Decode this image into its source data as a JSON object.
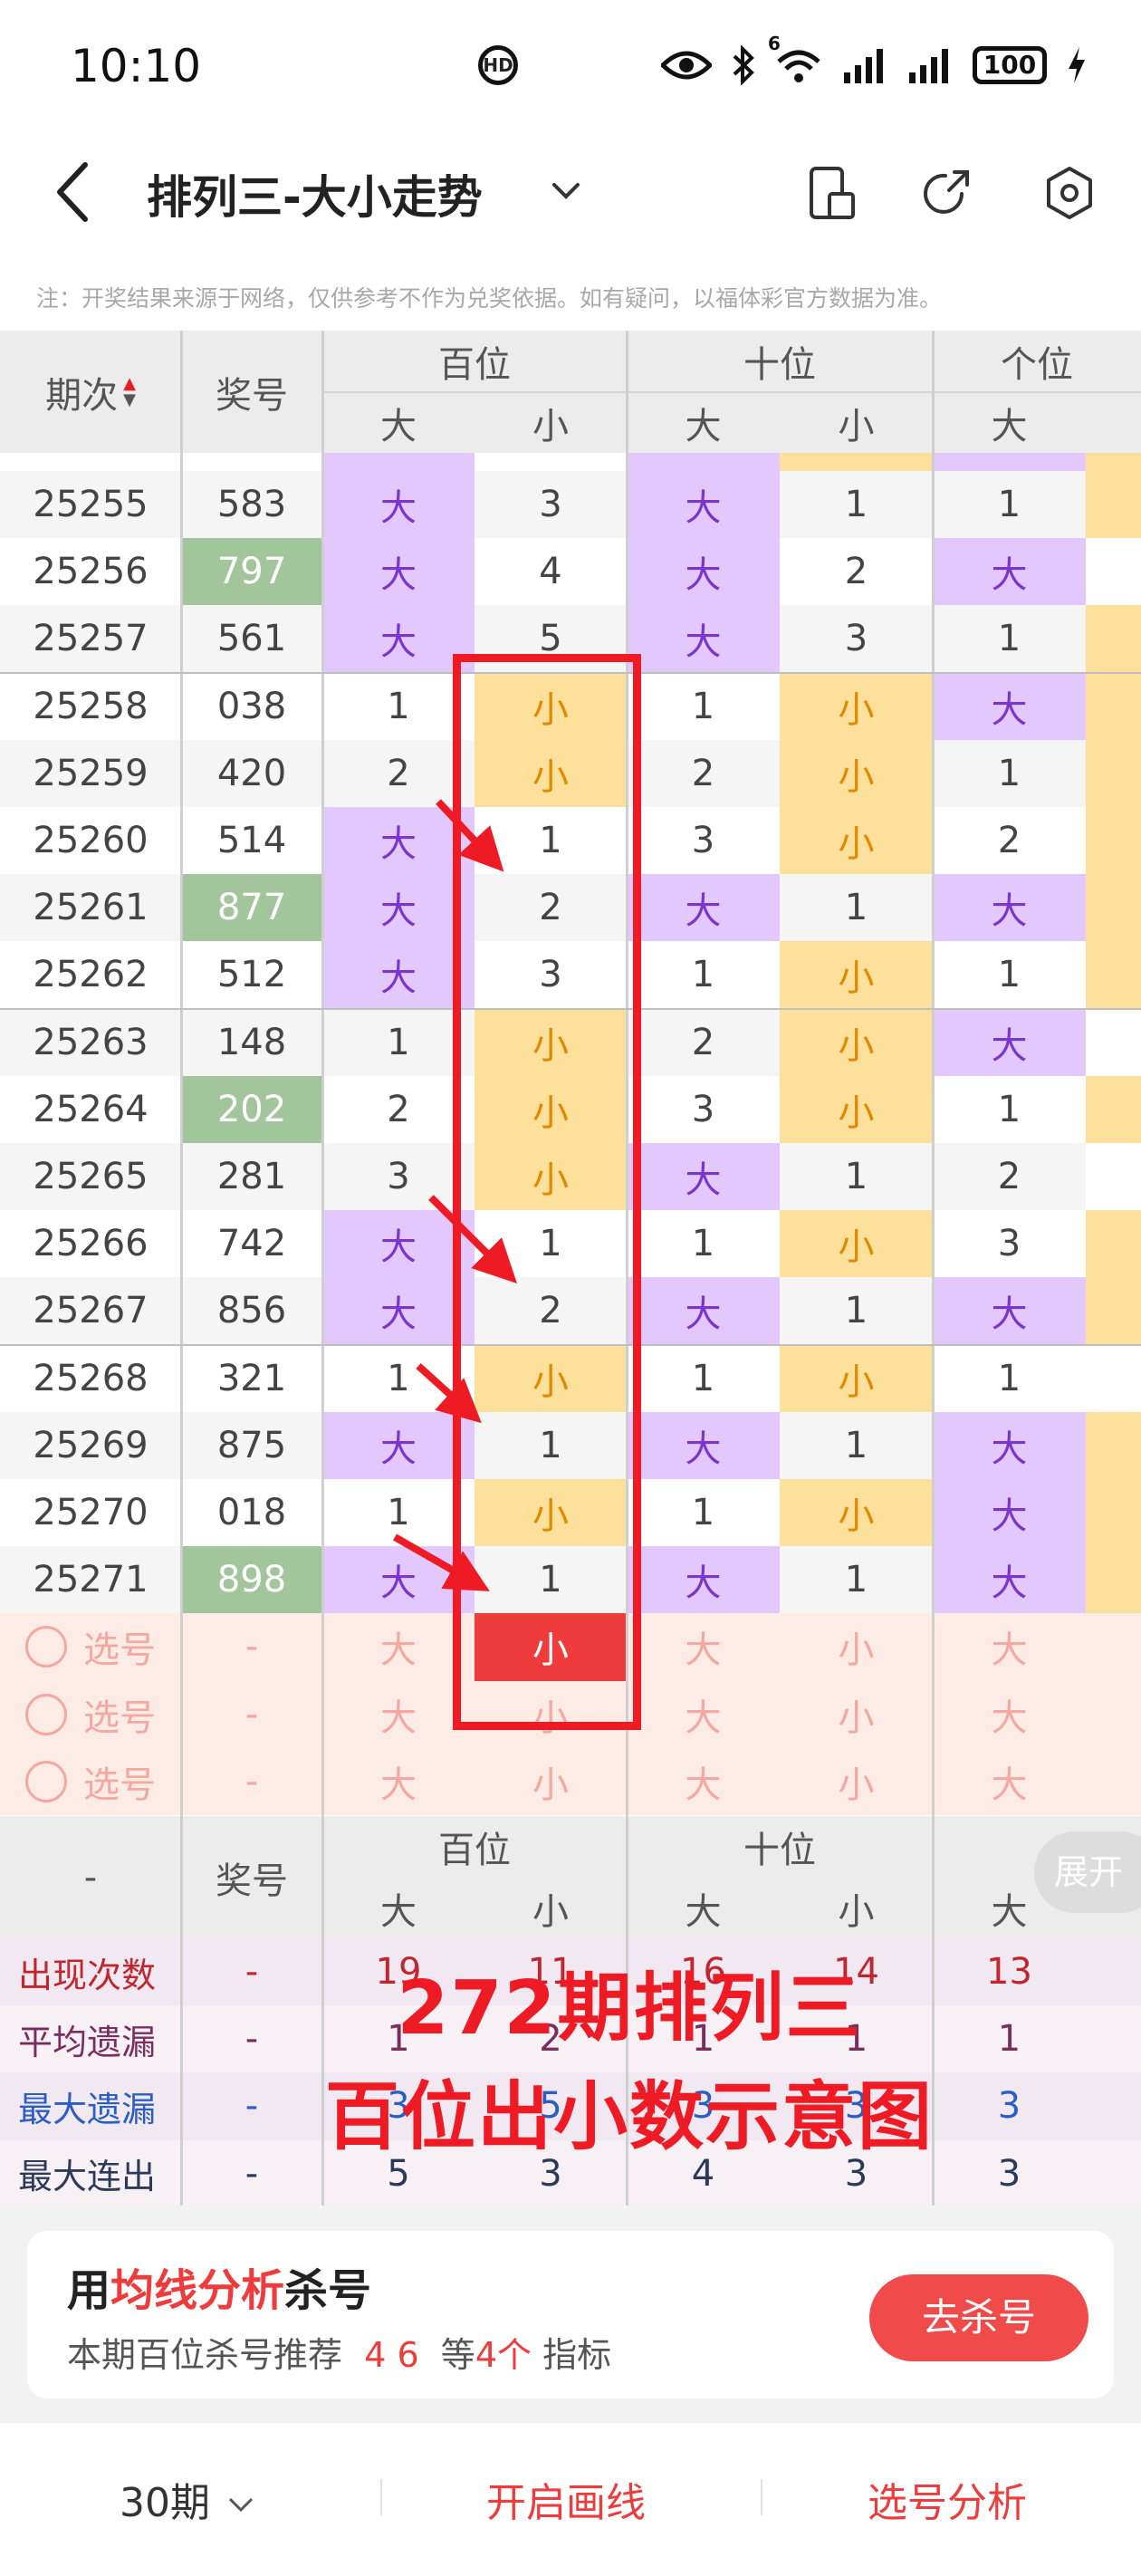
{
  "status_bar": {
    "time": "10:10",
    "signal_badge": "6",
    "battery": "100"
  },
  "header": {
    "title": "排列三-大小走势"
  },
  "notice": "注：开奖结果来源于网络，仅供参考不作为兑奖依据。如有疑问，以福体彩官方数据为准。",
  "table": {
    "col_period": "期次",
    "col_number": "奖号",
    "groups": [
      "百位",
      "十位",
      "个位"
    ],
    "sub_big": "大",
    "sub_small": "小",
    "rows": [
      {
        "period": "25255",
        "number": "583",
        "cells": [
          "大",
          "3",
          "大",
          "1",
          "1"
        ]
      },
      {
        "period": "25256",
        "number": "797",
        "cells": [
          "大",
          "4",
          "大",
          "2",
          "大"
        ]
      },
      {
        "period": "25257",
        "number": "561",
        "cells": [
          "大",
          "5",
          "大",
          "3",
          "1"
        ]
      },
      {
        "period": "25258",
        "number": "038",
        "cells": [
          "1",
          "小",
          "1",
          "小",
          "大"
        ]
      },
      {
        "period": "25259",
        "number": "420",
        "cells": [
          "2",
          "小",
          "2",
          "小",
          "1"
        ]
      },
      {
        "period": "25260",
        "number": "514",
        "cells": [
          "大",
          "1",
          "3",
          "小",
          "2"
        ]
      },
      {
        "period": "25261",
        "number": "877",
        "cells": [
          "大",
          "2",
          "大",
          "1",
          "大"
        ]
      },
      {
        "period": "25262",
        "number": "512",
        "cells": [
          "大",
          "3",
          "1",
          "小",
          "1"
        ]
      },
      {
        "period": "25263",
        "number": "148",
        "cells": [
          "1",
          "小",
          "2",
          "小",
          "大"
        ]
      },
      {
        "period": "25264",
        "number": "202",
        "cells": [
          "2",
          "小",
          "3",
          "小",
          "1"
        ]
      },
      {
        "period": "25265",
        "number": "281",
        "cells": [
          "3",
          "小",
          "大",
          "1",
          "2"
        ]
      },
      {
        "period": "25266",
        "number": "742",
        "cells": [
          "大",
          "1",
          "1",
          "小",
          "3"
        ]
      },
      {
        "period": "25267",
        "number": "856",
        "cells": [
          "大",
          "2",
          "大",
          "1",
          "大"
        ]
      },
      {
        "period": "25268",
        "number": "321",
        "cells": [
          "1",
          "小",
          "1",
          "小",
          "1"
        ]
      },
      {
        "period": "25269",
        "number": "875",
        "cells": [
          "大",
          "1",
          "大",
          "1",
          "大"
        ]
      },
      {
        "period": "25270",
        "number": "018",
        "cells": [
          "1",
          "小",
          "1",
          "小",
          "大"
        ]
      },
      {
        "period": "25271",
        "number": "898",
        "cells": [
          "大",
          "1",
          "大",
          "1",
          "大"
        ]
      }
    ],
    "pick_label": "选号",
    "pick_dash": "-",
    "pick_rows": [
      [
        "大",
        "小",
        "大",
        "小",
        "大"
      ],
      [
        "大",
        "小",
        "大",
        "小",
        "大"
      ],
      [
        "大",
        "小",
        "大",
        "小",
        "大"
      ]
    ]
  },
  "stats": {
    "dash": "-",
    "col_number": "奖号",
    "groups": [
      "百位",
      "十位",
      "个位"
    ],
    "sub_big": "大",
    "sub_small": "小",
    "rows": [
      {
        "label": "出现次数",
        "values": [
          "-",
          "19",
          "11",
          "16",
          "14",
          "13"
        ]
      },
      {
        "label": "平均遗漏",
        "values": [
          "-",
          "1",
          "2",
          "1",
          "1",
          "1"
        ]
      },
      {
        "label": "最大遗漏",
        "values": [
          "-",
          "3",
          "5",
          "3",
          "3",
          "3"
        ]
      },
      {
        "label": "最大连出",
        "values": [
          "-",
          "5",
          "3",
          "4",
          "3",
          "3"
        ]
      }
    ],
    "expand_label": "展开"
  },
  "overlay": {
    "line1": "272期排列三",
    "line2": "百位出小数示意图"
  },
  "promo": {
    "title_prefix": "用",
    "title_highlight": "均线分析",
    "title_suffix": "杀号",
    "sub_prefix": "本期百位杀号推荐",
    "sub_numbers": "4 6",
    "sub_mid": "等",
    "sub_count": "4个",
    "sub_suffix": "指标",
    "button": "去杀号"
  },
  "bottom": {
    "periods": "30期",
    "draw_line": "开启画线",
    "analysis": "选号分析"
  },
  "colors": {
    "purple": "#e3c8fd",
    "yellow": "#fde09b",
    "green": "#a3c59b",
    "red_accent": "#ee1b24",
    "pink_row": "#fdebe6"
  }
}
